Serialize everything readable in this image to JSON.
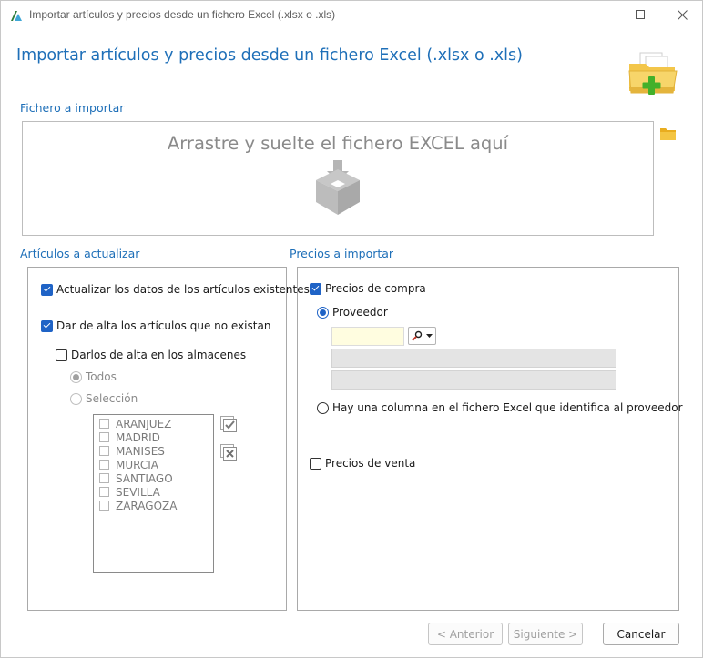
{
  "window": {
    "title": "Importar artículos y precios desde un fichero Excel (.xlsx o .xls)",
    "heading": "Importar artículos y precios desde un fichero Excel (.xlsx o .xls)"
  },
  "file_section": {
    "label": "Fichero a importar",
    "dropzone_text": "Arrastre y suelte el fichero EXCEL aquí"
  },
  "articles_section": {
    "label": "Artículos a actualizar",
    "update_existing": {
      "label": "Actualizar los datos de los artículos existentes",
      "checked": true
    },
    "create_missing": {
      "label": "Dar de alta los artículos que no existan",
      "checked": true
    },
    "create_in_warehouses": {
      "label": "Darlos de alta en los almacenes",
      "checked": false
    },
    "all_option": {
      "label": "Todos",
      "selected": true
    },
    "selection_option": {
      "label": "Selección",
      "selected": false
    },
    "warehouses": [
      "ARANJUEZ",
      "MADRID",
      "MANISES",
      "MURCIA",
      "SANTIAGO",
      "SEVILLA",
      "ZARAGOZA"
    ]
  },
  "prices_section": {
    "label": "Precios a importar",
    "purchase_prices": {
      "label": "Precios de compra",
      "checked": true
    },
    "supplier_option": {
      "label": "Proveedor",
      "selected": true
    },
    "supplier_code": "",
    "supplier_column_option": {
      "label": "Hay una columna en el fichero Excel que identifica al proveedor",
      "selected": false
    },
    "sale_prices": {
      "label": "Precios de venta",
      "checked": false
    }
  },
  "footer": {
    "back_label": "< Anterior",
    "next_label": "Siguiente >",
    "cancel_label": "Cancelar"
  },
  "colors": {
    "accent": "#1e6fb8",
    "checkbox_blue": "#1f63c6",
    "supplier_input_bg": "#fffde0"
  }
}
